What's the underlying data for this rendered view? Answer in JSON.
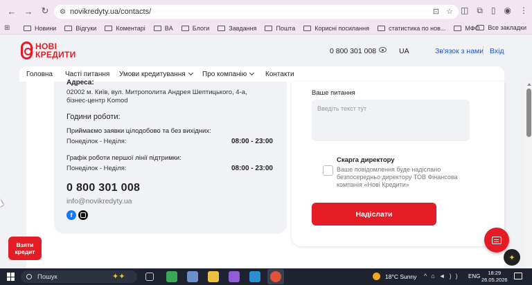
{
  "browser": {
    "url": "novikredyty.ua/contacts/",
    "bookmarks": [
      "Новини",
      "Відгуки",
      "Коментарі",
      "BA",
      "Блоги",
      "Завдання",
      "Пошта",
      "Корисні посилання",
      "статистика по нов...",
      "МФО"
    ],
    "more": "»",
    "all_bookmarks": "Все закладки"
  },
  "header": {
    "logo_line1": "НОВІ",
    "logo_line2": "КРЕДИТИ",
    "phone": "0 800 301 008",
    "lang": "UA",
    "contact_us": "Зв'язок з нами",
    "login": "Вхід",
    "accent": "#e31c25"
  },
  "menu": {
    "items": [
      "Головна",
      "Часті питання",
      "Умови кредитування",
      "Про компанію",
      "Контакти"
    ]
  },
  "contacts": {
    "address_title": "Адреса:",
    "address_text": "02002 м. Київ, вул. Митрополита Андрея Шептицького, 4-а, бізнес-центр Komod",
    "hours_title": "Години роботи:",
    "block1_label": "Приймаємо заявки цілодобово та без вихідних:",
    "block1_days": "Понеділок - Неділя:",
    "block1_time": "08:00 - 23:00",
    "block2_label": "Графік роботи першої лінії підтримки:",
    "block2_days": "Понеділок - Неділя:",
    "block2_time": "08:00 - 23:00",
    "phone": "0 800 301 008",
    "email": "info@novikredyty.ua",
    "facebook_letter": "f"
  },
  "form": {
    "question_label": "Ваше питання",
    "question_placeholder": "Введіть текст тут",
    "complaint_title": "Скарга директору",
    "complaint_text": "Ваше повідомлення буде надіслано безпосередньо директору ТОВ Фінансова компанія «Нові Кредити»",
    "submit_label": "Надіслати"
  },
  "floating": {
    "credit_line1": "Взяти",
    "credit_line2": "кредит",
    "spark_glyph": "✦"
  },
  "taskbar": {
    "search_label": "Пошук",
    "weather": "18°C  Sunny",
    "lang": "ENG",
    "time": "18:29",
    "date": "26.05.2026"
  }
}
